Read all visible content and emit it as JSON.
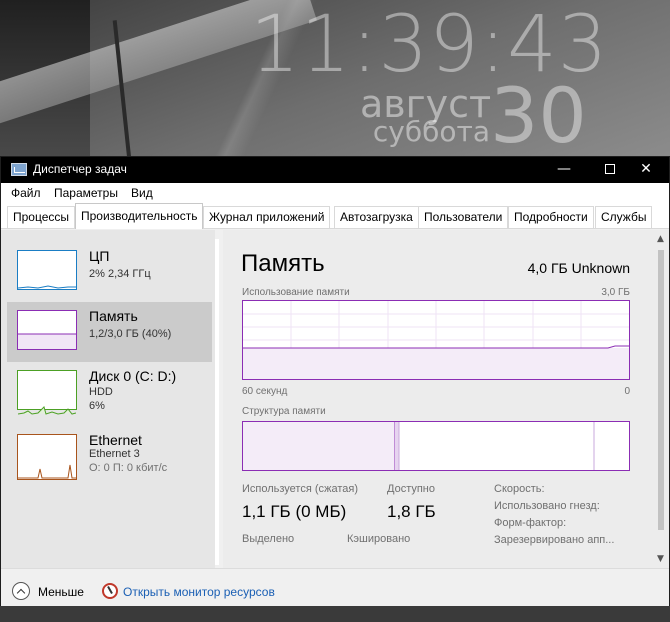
{
  "desktop": {
    "time": "11:39:43",
    "month": "август",
    "weekday": "суббота",
    "day": "30"
  },
  "window": {
    "title": "Диспетчер задач",
    "controls": {
      "minimize": "—",
      "close": "✕"
    }
  },
  "menu": {
    "items": [
      "Файл",
      "Параметры",
      "Вид"
    ]
  },
  "tabs": [
    {
      "label": "Процессы",
      "active": false
    },
    {
      "label": "Производительность",
      "active": true
    },
    {
      "label": "Журнал приложений",
      "active": false
    },
    {
      "label": "Автозагрузка",
      "active": false
    },
    {
      "label": "Пользователи",
      "active": false
    },
    {
      "label": "Подробности",
      "active": false
    },
    {
      "label": "Службы",
      "active": false
    }
  ],
  "sidebar": {
    "items": [
      {
        "name": "ЦП",
        "line1": "2% 2,34 ГГц",
        "line2": "",
        "color": "#1a7dc4",
        "selected": false
      },
      {
        "name": "Память",
        "line1": "1,2/3,0 ГБ (40%)",
        "line2": "",
        "color": "#8b2db4",
        "selected": true
      },
      {
        "name": "Диск 0 (C: D:)",
        "line1": "HDD",
        "line2": "6%",
        "color": "#4ca024",
        "selected": false
      },
      {
        "name": "Ethernet",
        "line1": "Ethernet 3",
        "line2": "О: 0 П: 0 кбит/с",
        "color": "#a8541c",
        "selected": false
      }
    ]
  },
  "main": {
    "title": "Память",
    "total": "4,0 ГБ Unknown",
    "usage_label": "Использование памяти",
    "usage_max": "3,0 ГБ",
    "time_left": "60 секунд",
    "time_right": "0",
    "composition_label": "Структура памяти",
    "usage_level": 0.4,
    "stats": {
      "in_use_label": "Используется (сжатая)",
      "in_use_value": "1,1 ГБ (0 МБ)",
      "available_label": "Доступно",
      "available_value": "1,8 ГБ",
      "committed_label": "Выделено",
      "cached_label": "Кэшировано"
    },
    "specs": {
      "speed": "Скорость:",
      "slots": "Использовано гнезд:",
      "form": "Форм-фактор:",
      "reserved": "Зарезервировано апп..."
    }
  },
  "footer": {
    "less_label": "Меньше",
    "monitor_link": "Открыть монитор ресурсов"
  }
}
